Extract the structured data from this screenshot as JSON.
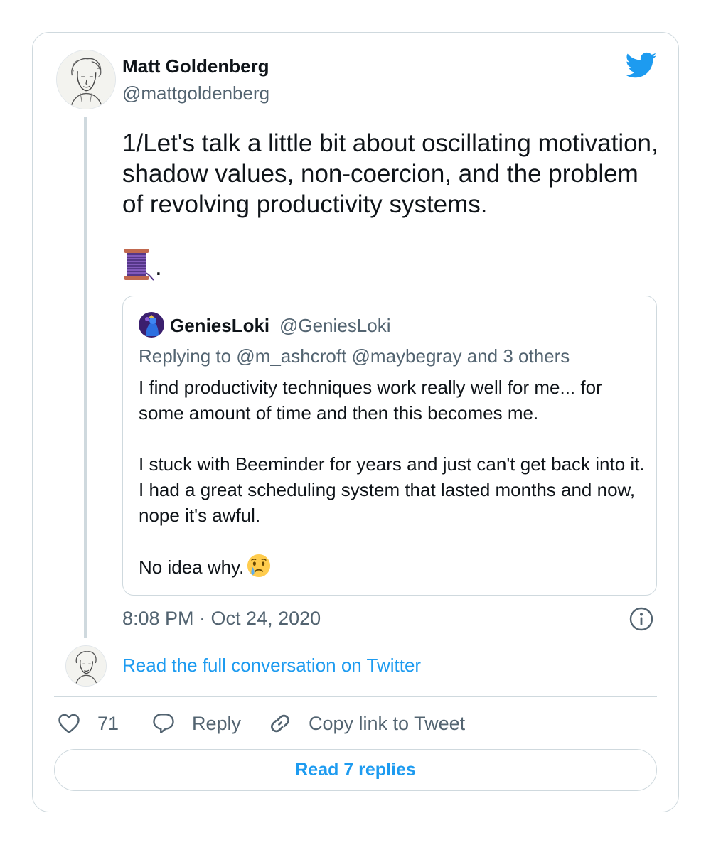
{
  "tweet": {
    "author_name": "Matt Goldenberg",
    "author_handle": "@mattgoldenberg",
    "text": "1/Let's talk a little bit about oscillating motivation, shadow values, non-coercion, and the problem of revolving productivity systems.",
    "thread_suffix": ".",
    "timestamp": "8:08 PM · Oct 24, 2020"
  },
  "quoted": {
    "name": "GeniesLoki",
    "handle": "@GeniesLoki",
    "replying_to": "Replying to @m_ashcroft @maybegray and 3 others",
    "text": "I find productivity techniques work really well for me... for some amount of time and then this becomes me.\n\nI stuck with Beeminder for years and just can't get back into it. I had a great scheduling system that lasted months and now, nope it's awful.\n\nNo idea why."
  },
  "conversation_link": "Read the full conversation on Twitter",
  "actions": {
    "like_count": "71",
    "reply_label": "Reply",
    "copy_label": "Copy link to Tweet"
  },
  "read_replies": "Read 7 replies",
  "icons": {
    "brand": "twitter-bird-icon",
    "thread": "spool-of-thread-icon",
    "emoji": "crying-face-icon",
    "info": "info-icon",
    "like": "heart-icon",
    "reply": "speech-bubble-icon",
    "copy": "link-icon"
  },
  "colors": {
    "accent": "#1d9bf0",
    "text": "#0f1419",
    "secondary": "#536471",
    "border": "#cfd9de"
  }
}
